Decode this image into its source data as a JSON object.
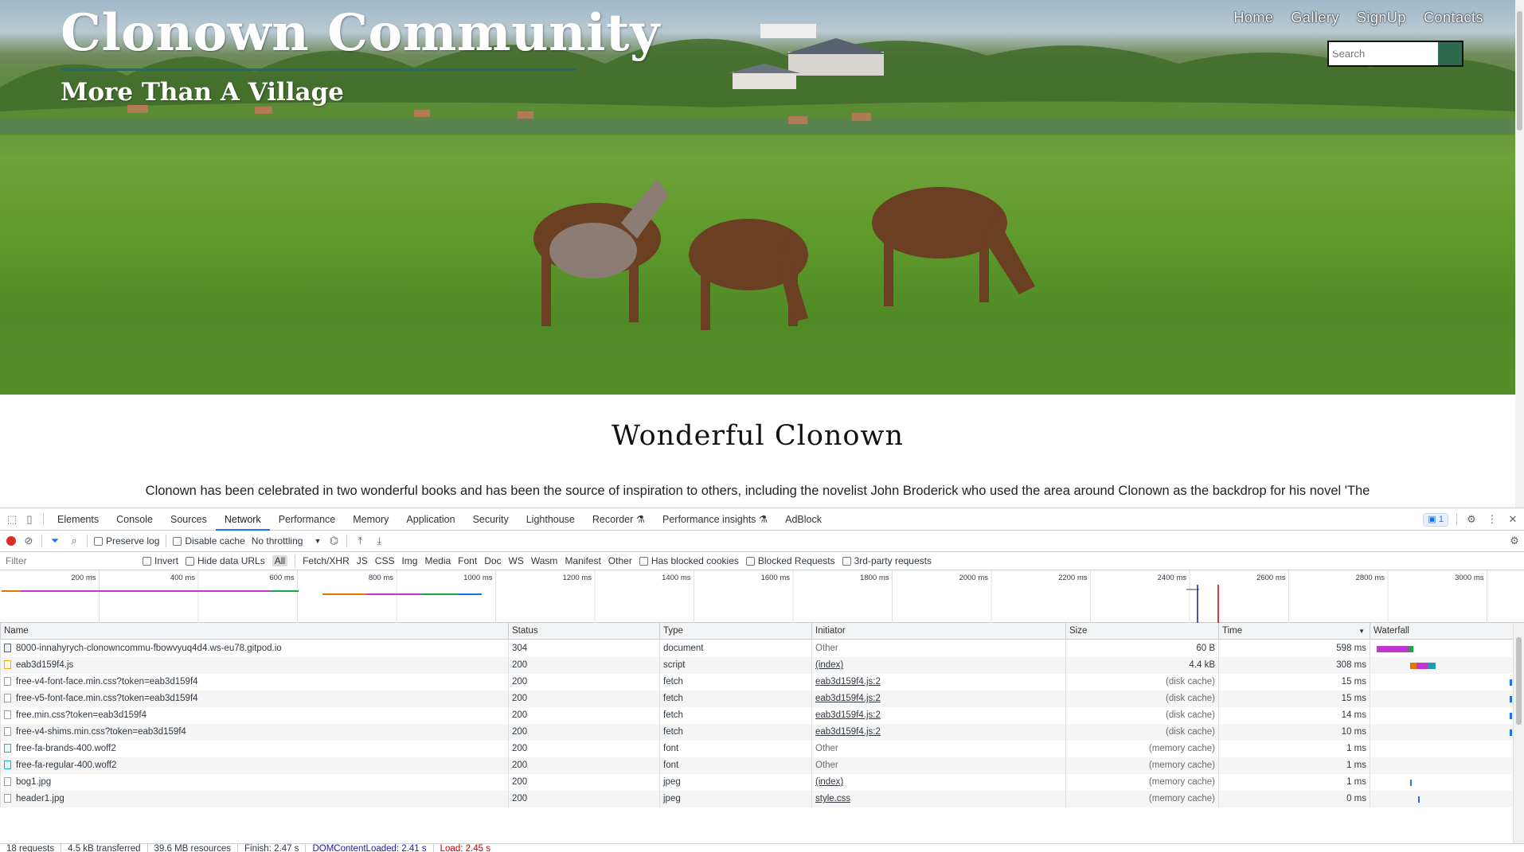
{
  "site": {
    "title": "Clonown Community",
    "subtitle": "More Than A Village",
    "nav": [
      "Home",
      "Gallery",
      "SignUp",
      "Contacts"
    ],
    "search_placeholder": "Search",
    "heading": "Wonderful Clonown",
    "intro": "Clonown has been celebrated in two wonderful books and has been the source of inspiration to others, including the novelist John Broderick who used the area around Clonown as the backdrop for his novel 'The"
  },
  "devtools": {
    "tabs": [
      "Elements",
      "Console",
      "Sources",
      "Network",
      "Performance",
      "Memory",
      "Application",
      "Security",
      "Lighthouse",
      "Recorder",
      "Performance insights",
      "AdBlock"
    ],
    "active_tab": "Network",
    "issues_badge": "1",
    "toolbar": {
      "preserve_log": "Preserve log",
      "disable_cache": "Disable cache",
      "throttling": "No throttling"
    },
    "filter": {
      "placeholder": "Filter",
      "invert": "Invert",
      "hide_data_urls": "Hide data URLs",
      "types": [
        "All",
        "Fetch/XHR",
        "JS",
        "CSS",
        "Img",
        "Media",
        "Font",
        "Doc",
        "WS",
        "Wasm",
        "Manifest",
        "Other"
      ],
      "active_type": "All",
      "has_blocked_cookies": "Has blocked cookies",
      "blocked_requests": "Blocked Requests",
      "third_party": "3rd-party requests"
    },
    "timeline_ticks": [
      "200 ms",
      "400 ms",
      "600 ms",
      "800 ms",
      "1000 ms",
      "1200 ms",
      "1400 ms",
      "1600 ms",
      "1800 ms",
      "2000 ms",
      "2200 ms",
      "2400 ms",
      "2600 ms",
      "2800 ms",
      "3000 ms"
    ],
    "columns": [
      "Name",
      "Status",
      "Type",
      "Initiator",
      "Size",
      "Time",
      "Waterfall"
    ],
    "rows": [
      {
        "name": "8000-innahyrych-clonowncommu-fbowvyuq4d4.ws-eu78.gitpod.io",
        "status": "304",
        "type": "document",
        "initiator": "Other",
        "size": "60 B",
        "time": "598 ms",
        "icon": "doc"
      },
      {
        "name": "eab3d159f4.js",
        "status": "200",
        "type": "script",
        "initiator": "(index)",
        "size": "4.4 kB",
        "time": "308 ms",
        "icon": "js"
      },
      {
        "name": "free-v4-font-face.min.css?token=eab3d159f4",
        "status": "200",
        "type": "fetch",
        "initiator": "eab3d159f4.js:2",
        "size": "(disk cache)",
        "time": "15 ms",
        "icon": "plain"
      },
      {
        "name": "free-v5-font-face.min.css?token=eab3d159f4",
        "status": "200",
        "type": "fetch",
        "initiator": "eab3d159f4.js:2",
        "size": "(disk cache)",
        "time": "15 ms",
        "icon": "plain"
      },
      {
        "name": "free.min.css?token=eab3d159f4",
        "status": "200",
        "type": "fetch",
        "initiator": "eab3d159f4.js:2",
        "size": "(disk cache)",
        "time": "14 ms",
        "icon": "plain"
      },
      {
        "name": "free-v4-shims.min.css?token=eab3d159f4",
        "status": "200",
        "type": "fetch",
        "initiator": "eab3d159f4.js:2",
        "size": "(disk cache)",
        "time": "10 ms",
        "icon": "plain"
      },
      {
        "name": "free-fa-brands-400.woff2",
        "status": "200",
        "type": "font",
        "initiator": "Other",
        "size": "(memory cache)",
        "time": "1 ms",
        "icon": "font"
      },
      {
        "name": "free-fa-regular-400.woff2",
        "status": "200",
        "type": "font",
        "initiator": "Other",
        "size": "(memory cache)",
        "time": "1 ms",
        "icon": "font"
      },
      {
        "name": "bog1.jpg",
        "status": "200",
        "type": "jpeg",
        "initiator": "(index)",
        "size": "(memory cache)",
        "time": "1 ms",
        "icon": "plain"
      },
      {
        "name": "header1.jpg",
        "status": "200",
        "type": "jpeg",
        "initiator": "style.css",
        "size": "(memory cache)",
        "time": "0 ms",
        "icon": "plain"
      }
    ],
    "status_bar": {
      "requests": "18 requests",
      "transferred": "4.5 kB transferred",
      "resources": "39.6 MB resources",
      "finish": "Finish: 2.47 s",
      "dom_content_loaded": "DOMContentLoaded: 2.41 s",
      "load": "Load: 2.45 s"
    },
    "colors": {
      "accent": "#1a73e8",
      "record": "#d93025",
      "dcl": "#1a1aa6",
      "load": "#c80000"
    }
  }
}
